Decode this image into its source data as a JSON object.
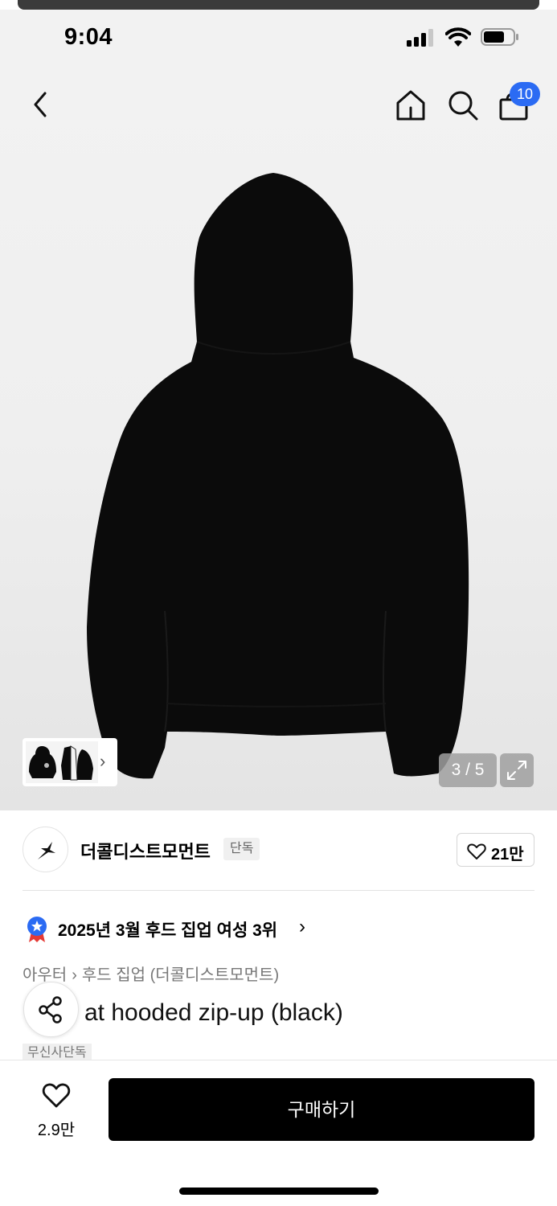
{
  "status_bar": {
    "time": "9:04"
  },
  "header": {
    "cart_count": "10"
  },
  "gallery": {
    "counter": "3 / 5"
  },
  "brand": {
    "name": "더콜디스트모먼트",
    "tag": "단독",
    "likes": "21만"
  },
  "ranking": {
    "text": "2025년 3월 후드 집업 여성 3위"
  },
  "breadcrumb": {
    "items": [
      "아우터",
      "후드 집업 (더콜디스트모먼트)"
    ]
  },
  "product": {
    "title": "at hooded zip-up (black)",
    "exclusive_tag": "무신사단독"
  },
  "bottom_bar": {
    "wish_count": "2.9만",
    "buy_label": "구매하기"
  },
  "colors": {
    "badge": "#2b6bf3",
    "buy_button": "#000000",
    "ranking_badge": "#2b6bf3"
  }
}
